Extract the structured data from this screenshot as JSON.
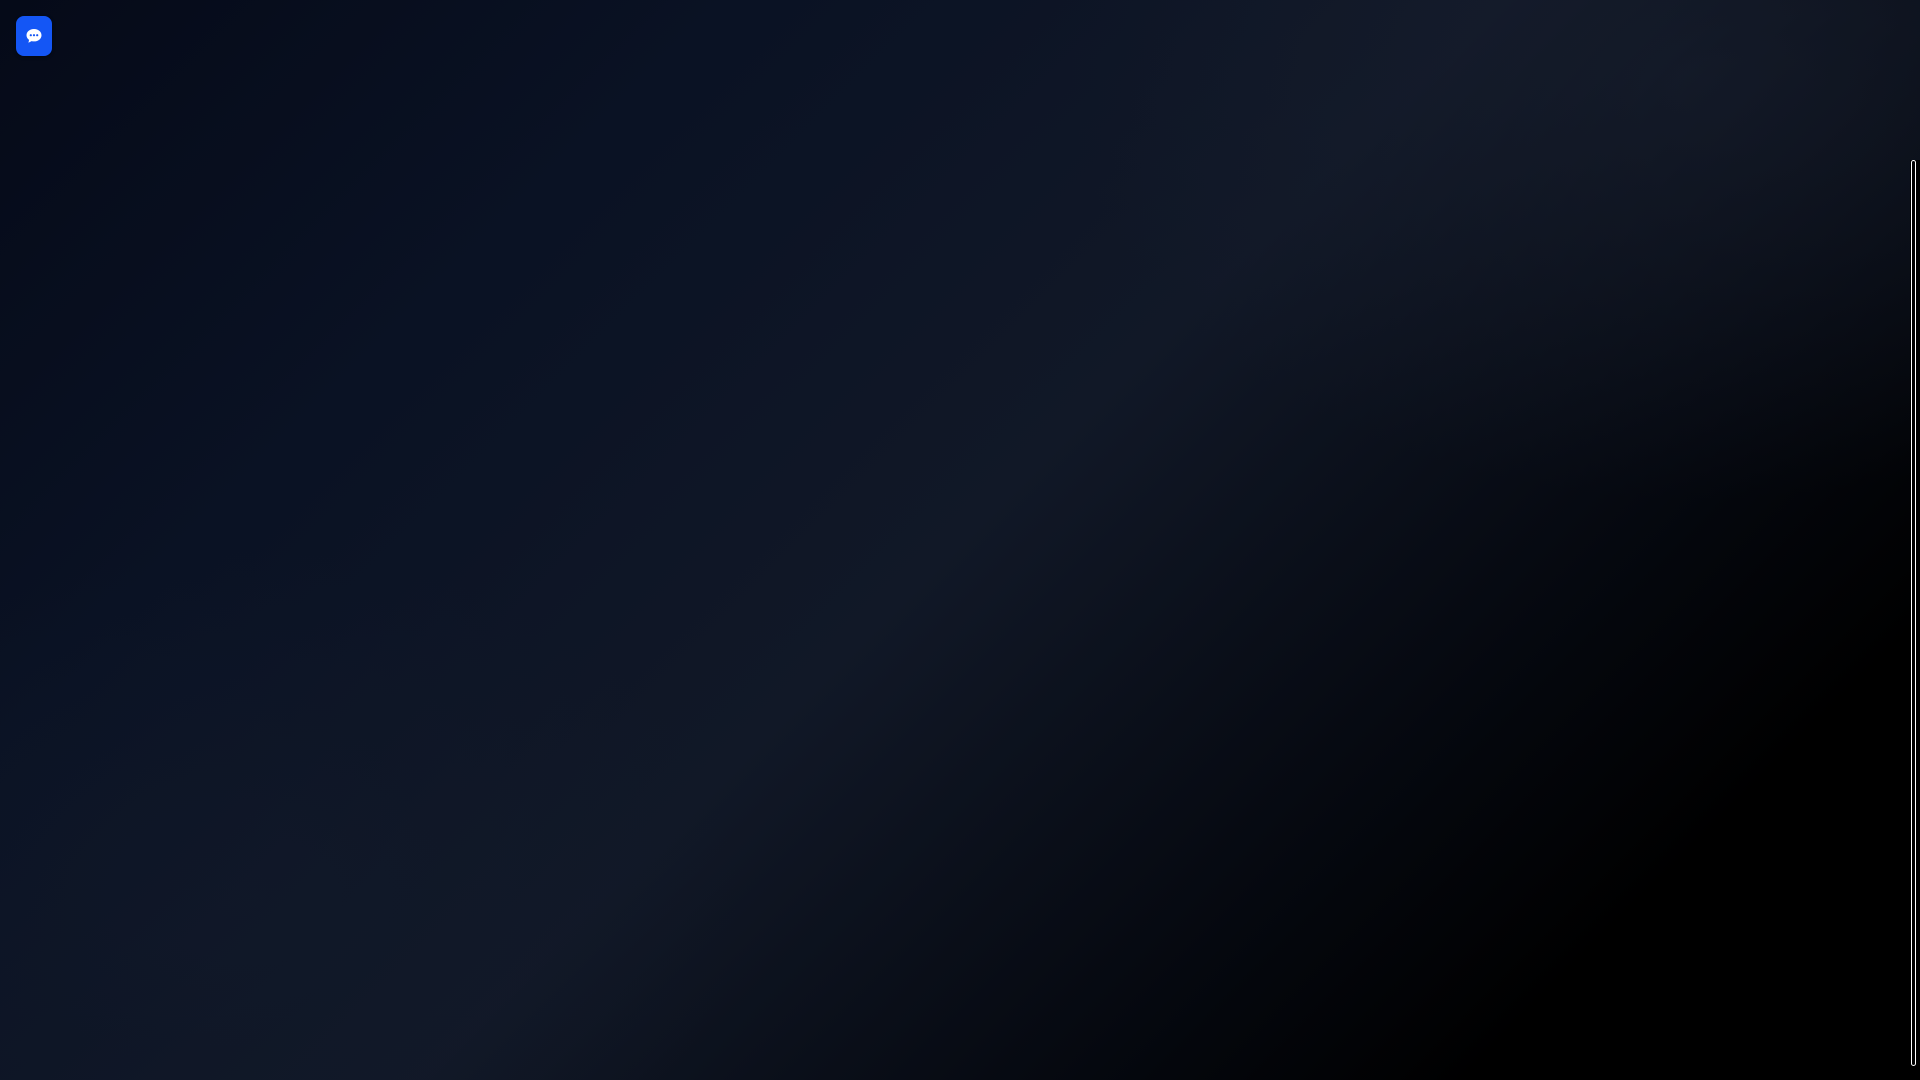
{
  "theme": {
    "background_colors": [
      "#050a18",
      "#111827",
      "#000000"
    ],
    "accent": "#1456f5"
  },
  "chat_launcher": {
    "icon": "chat-bubble-icon",
    "color": "#1456f5"
  },
  "scrollbar": {
    "thumb_border_color": "#ffffff"
  }
}
